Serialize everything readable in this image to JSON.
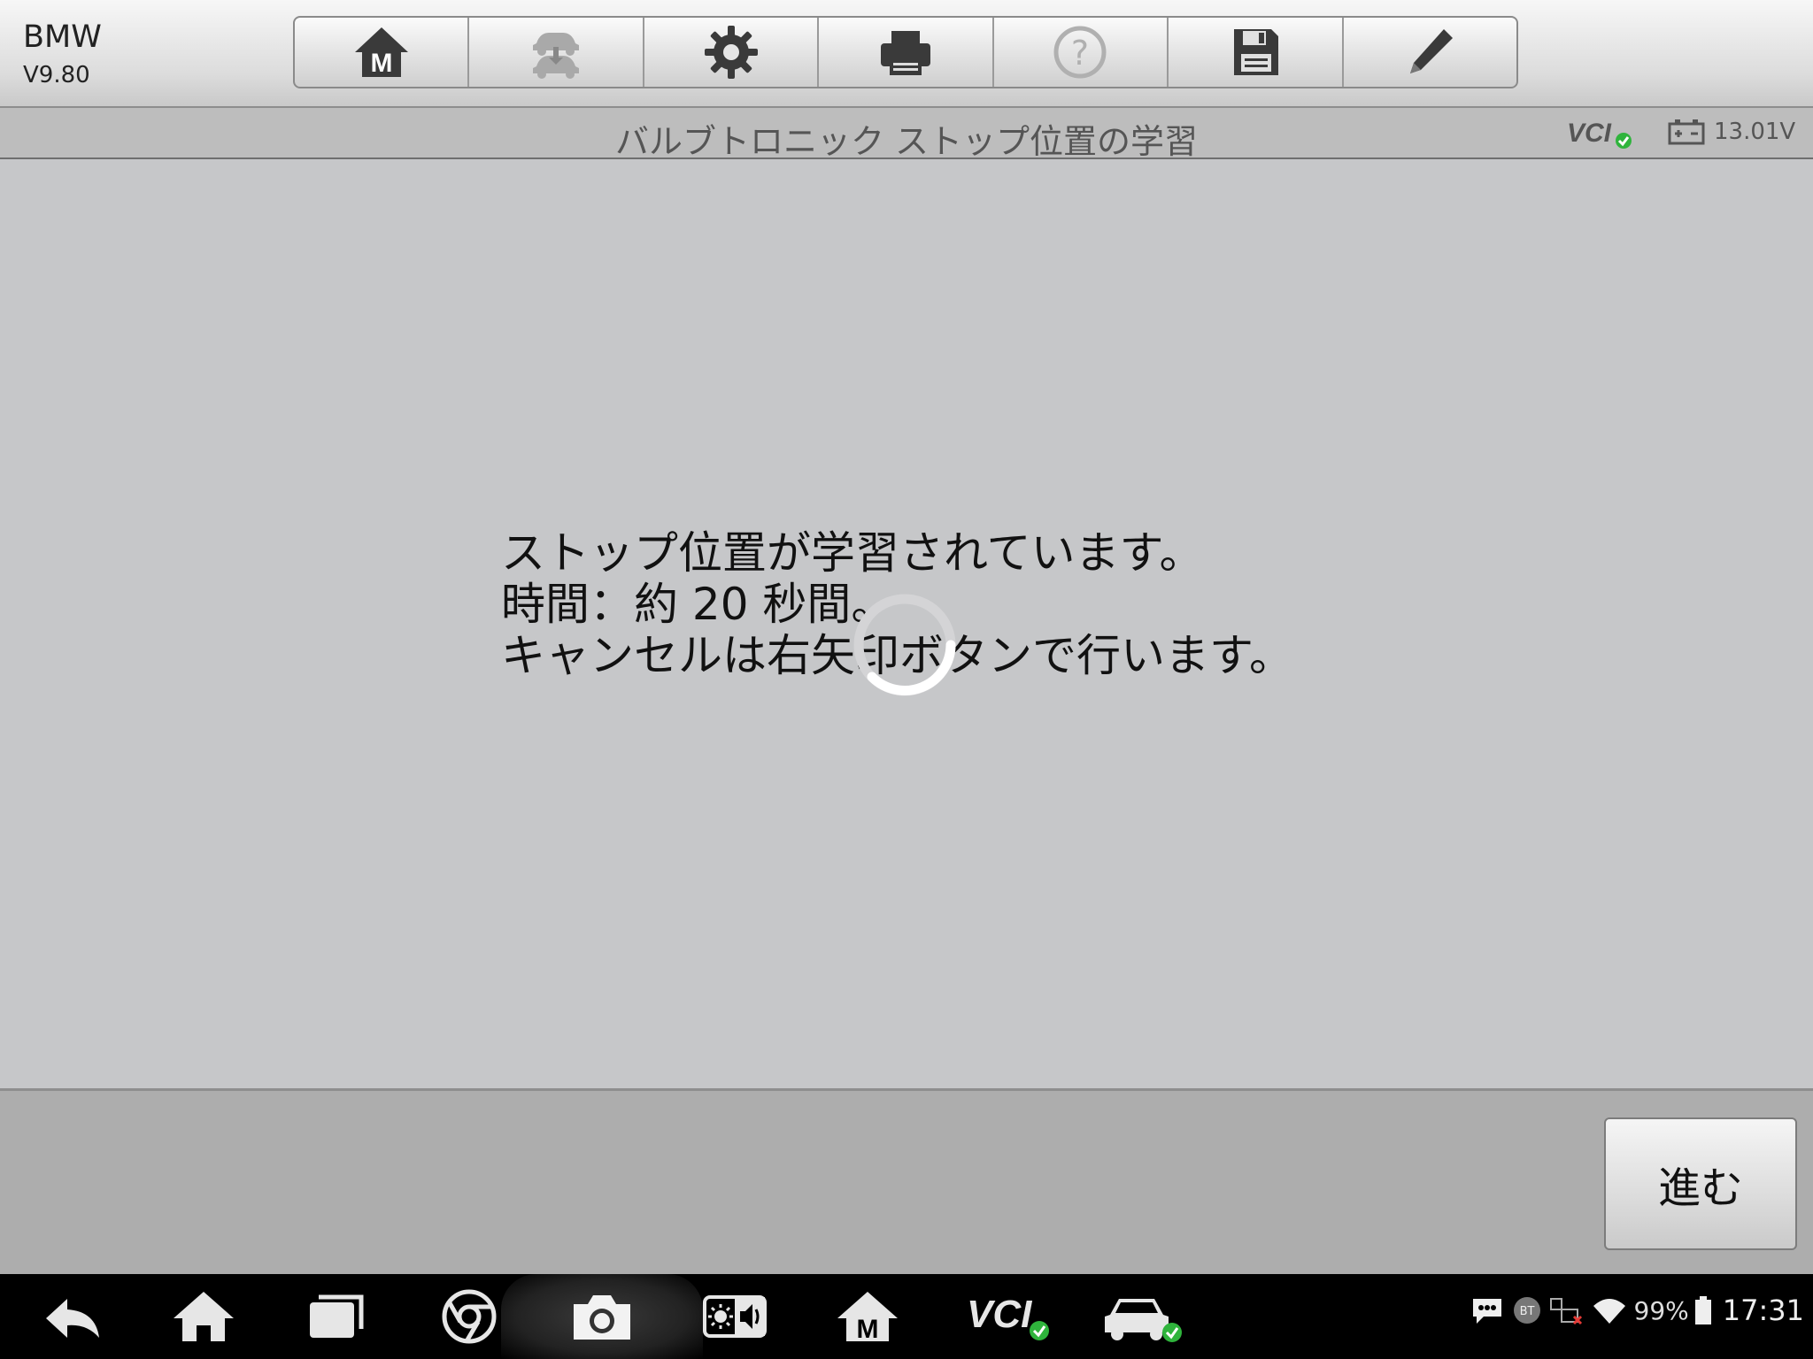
{
  "app": {
    "name": "BMW",
    "version": "V9.80"
  },
  "toolbar": {
    "buttons": [
      {
        "id": "home",
        "icon": "home-m-icon"
      },
      {
        "id": "vehicle-swap",
        "icon": "vehicle-swap-icon"
      },
      {
        "id": "settings",
        "icon": "gear-icon"
      },
      {
        "id": "print",
        "icon": "printer-icon"
      },
      {
        "id": "help",
        "icon": "help-icon"
      },
      {
        "id": "save",
        "icon": "floppy-disk-icon"
      },
      {
        "id": "edit",
        "icon": "pencil-icon"
      }
    ]
  },
  "titlebar": {
    "title": "バルブトロニック ストップ位置の学習",
    "vci_label": "VCI",
    "battery_voltage": "13.01V"
  },
  "main": {
    "message_lines": [
      "ストップ位置が学習されています。",
      "時間：約 20 秒間。",
      "キャンセルは右矢印ボタンで行います。"
    ]
  },
  "footer": {
    "next_label": "進む"
  },
  "navbar": {
    "vci_label": "VCI",
    "battery_percent": "99%",
    "time": "17:31",
    "bt_label": "BT"
  }
}
